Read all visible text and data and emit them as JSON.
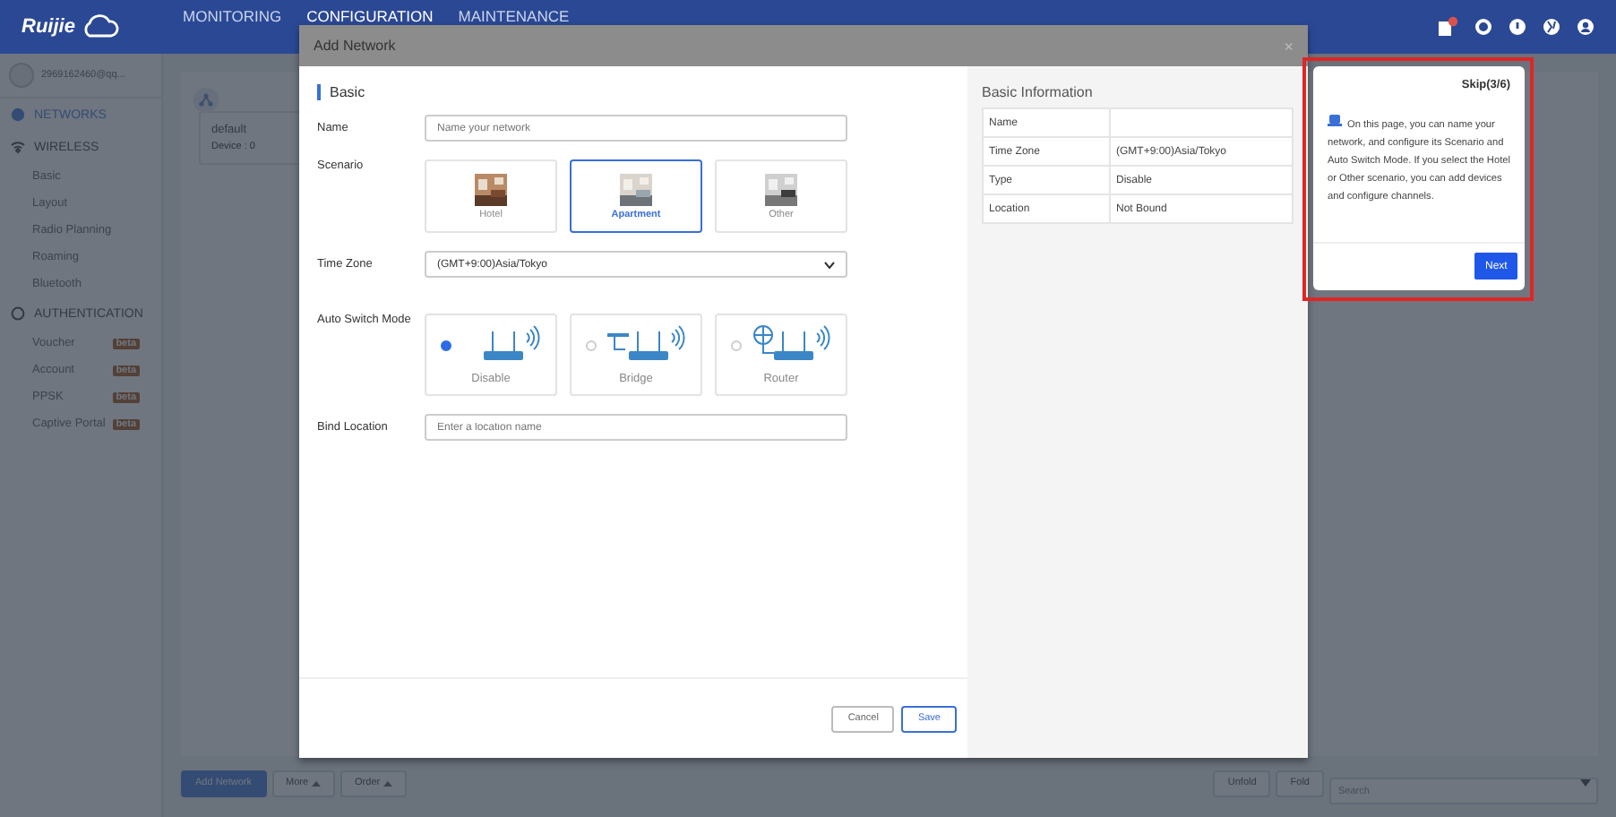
{
  "header": {
    "logo": "Ruijie",
    "nav": [
      {
        "label": "MONITORING",
        "selected": false
      },
      {
        "label": "CONFIGURATION",
        "selected": true
      },
      {
        "label": "MAINTENANCE",
        "selected": false
      }
    ]
  },
  "sidebar": {
    "account": "2969162460@qq...",
    "sections": [
      {
        "kind": "networks",
        "title": "NETWORKS",
        "selected": true
      },
      {
        "kind": "wireless",
        "title": "WIRELESS",
        "selected": false,
        "items": [
          {
            "label": "Basic"
          },
          {
            "label": "Layout"
          },
          {
            "label": "Radio Planning"
          },
          {
            "label": "Roaming"
          },
          {
            "label": "Bluetooth"
          }
        ]
      },
      {
        "kind": "authentication",
        "title": "AUTHENTICATION",
        "selected": false,
        "items": [
          {
            "label": "Voucher",
            "badge": "beta"
          },
          {
            "label": "Account",
            "badge": "beta"
          },
          {
            "label": "PPSK",
            "badge": "beta"
          },
          {
            "label": "Captive Portal",
            "badge": "beta"
          }
        ]
      }
    ]
  },
  "network_card": {
    "name": "default",
    "devices": "Device : 0"
  },
  "toolbar": {
    "left": [
      {
        "kind": "primary",
        "label": "Add Network"
      },
      {
        "kind": "dropdown",
        "label": "More"
      },
      {
        "kind": "dropdown",
        "label": "Order"
      }
    ],
    "right": [
      {
        "label": "Unfold"
      },
      {
        "label": "Fold"
      }
    ],
    "search": {
      "placeholder": "Search"
    }
  },
  "dialog": {
    "title": "Add Network",
    "close": "×",
    "section": "Basic",
    "name": {
      "label": "Name",
      "placeholder": "Name your network"
    },
    "scenario": {
      "label": "Scenario",
      "options": [
        {
          "label": "Hotel",
          "selected": false
        },
        {
          "label": "Apartment",
          "selected": true
        },
        {
          "label": "Other",
          "selected": false
        }
      ]
    },
    "time_zone": {
      "label": "Time Zone",
      "value": "(GMT+9:00)Asia/Tokyo"
    },
    "auto_switch": {
      "label": "Auto Switch Mode",
      "options": [
        {
          "kind": "disable",
          "label": "Disable",
          "selected": true
        },
        {
          "kind": "bridge",
          "label": "Bridge",
          "selected": false
        },
        {
          "kind": "router",
          "label": "Router",
          "selected": false
        }
      ]
    },
    "bind_location": {
      "label": "Bind Location",
      "placeholder": "Enter a location name"
    },
    "buttons": [
      {
        "kind": "cancel",
        "label": "Cancel"
      },
      {
        "kind": "save",
        "label": "Save"
      }
    ]
  },
  "info": {
    "title": "Basic Information",
    "rows": [
      {
        "label": "Name"
      },
      {
        "label": "Time Zone",
        "value": "(GMT+9:00)Asia/Tokyo"
      },
      {
        "label": "Type",
        "value": "Disable"
      },
      {
        "label": "Location",
        "value": "Not Bound"
      }
    ]
  },
  "tour": {
    "skip": "Skip(3/6)",
    "text": "On this page, you can name your network, and configure its Scenario and Auto Switch Mode. If you select the Hotel or Other scenario, you can add devices and configure channels.",
    "button": "Next"
  }
}
